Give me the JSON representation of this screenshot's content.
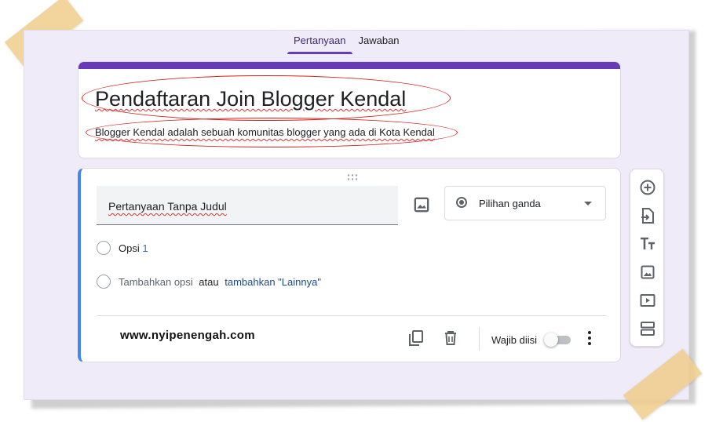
{
  "tabs": [
    {
      "label": "Pertanyaan",
      "active": true
    },
    {
      "label": "Jawaban",
      "active": false
    }
  ],
  "form": {
    "title": "Pendaftaran Join Blogger Kendal",
    "description": "Blogger Kendal adalah sebuah komunitas blogger yang ada di Kota Kendal",
    "accent_color": "#673ab7"
  },
  "question": {
    "title": "Pertanyaan Tanpa Judul",
    "type": "Pilihan ganda",
    "option1_label": "Opsi",
    "option1_number": "1",
    "add_option": "Tambahkan opsi",
    "or_text": "atau",
    "add_other": "tambahkan \"Lainnya\"",
    "required_label": "Wajib diisi",
    "required": false
  },
  "watermark": "www.nyipenengah.com",
  "toolbar": [
    "add-question-icon",
    "import-questions-icon",
    "add-title-icon",
    "add-image-icon",
    "add-video-icon",
    "add-section-icon"
  ]
}
